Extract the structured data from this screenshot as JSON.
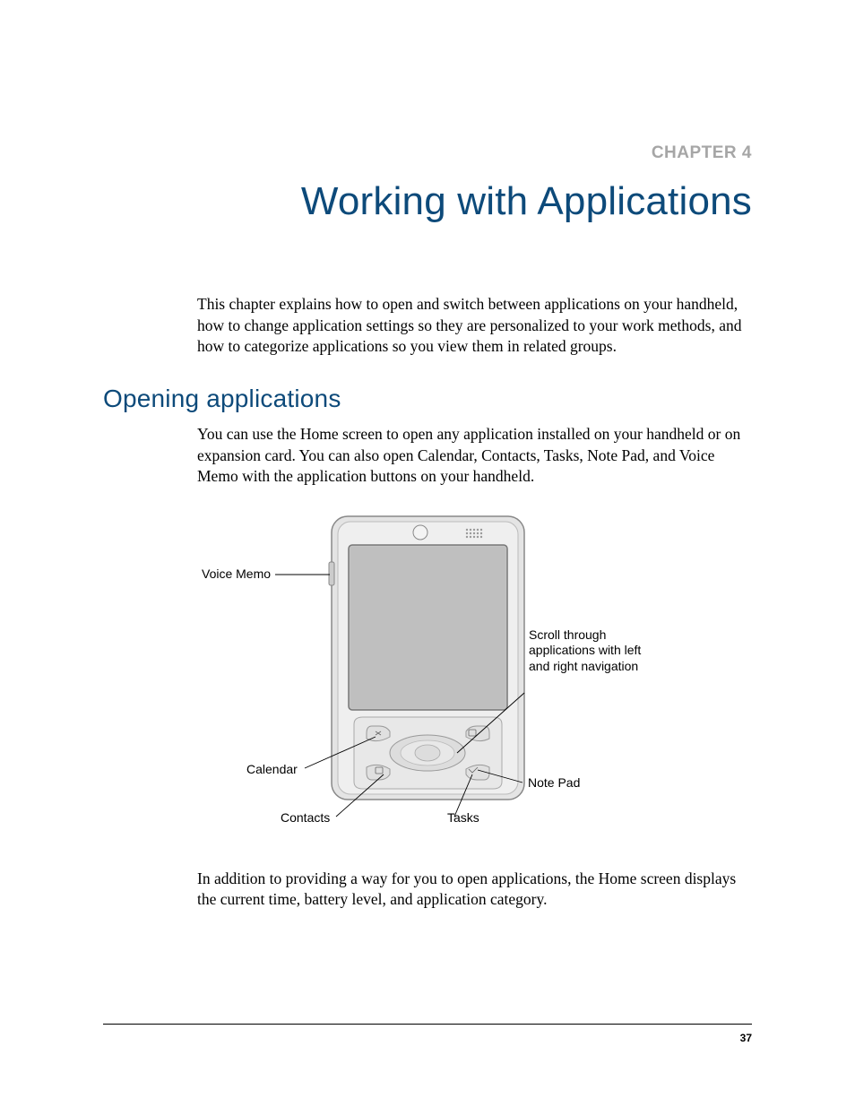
{
  "chapter": {
    "label": "CHAPTER 4",
    "title": "Working with Applications"
  },
  "intro": "This chapter explains how to open and switch between applications on your handheld, how to change application settings so they are personalized to your work methods, and how to categorize applications so you view them in related groups.",
  "section1": {
    "heading": "Opening applications",
    "para1": "You can use the Home screen to open any application installed on your handheld or on expansion card. You can also open Calendar, Contacts, Tasks, Note Pad, and Voice Memo with the application buttons on your handheld.",
    "para2": "In addition to providing a way for you to open applications, the Home screen displays the current time, battery level, and application category."
  },
  "callouts": {
    "voice_memo": "Voice Memo",
    "calendar": "Calendar",
    "contacts": "Contacts",
    "tasks": "Tasks",
    "note_pad": "Note Pad",
    "scroll": "Scroll through applications with left and right navigation"
  },
  "page_number": "37"
}
